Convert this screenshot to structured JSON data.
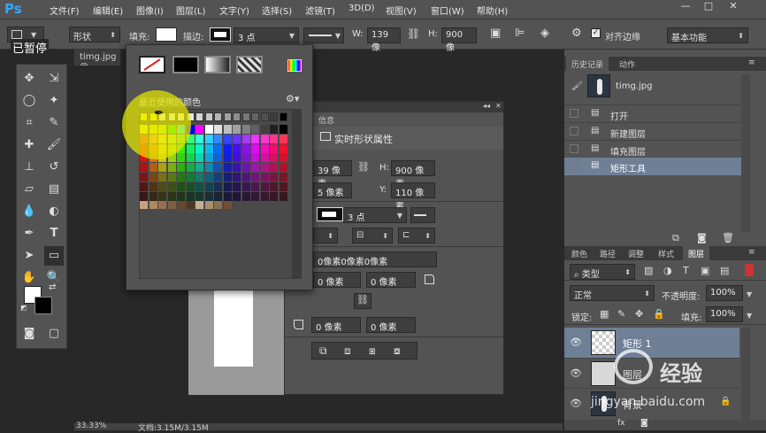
{
  "app": {
    "logo": "Ps"
  },
  "menu": {
    "items": [
      "文件(F)",
      "编辑(E)",
      "图像(I)",
      "图层(L)",
      "文字(Y)",
      "选择(S)",
      "滤镜(T)",
      "3D(D)",
      "视图(V)",
      "窗口(W)",
      "帮助(H)"
    ]
  },
  "options": {
    "shape_mode": "形状",
    "fill_label": "填充:",
    "stroke_label": "描边:",
    "stroke_width": "3 点",
    "w_label": "W:",
    "w_value": "139 像",
    "h_label": "H:",
    "h_value": "900 像",
    "align_edges_label": "对齐边缘",
    "workspace": "基本功能"
  },
  "overlay_text": "已暂停",
  "document": {
    "tab": "timg.jpg @",
    "zoom": "33.33%",
    "doc_size": "文档:3.15M/3.15M"
  },
  "swatch_panel": {
    "title": "最近使用的颜色"
  },
  "properties": {
    "tab": "信息",
    "title": "实时形状属性",
    "w_value": "39 像素",
    "h_label": "H:",
    "h_value": "900 像素",
    "x_value": "5 像素",
    "y_label": "Y:",
    "y_value": "110 像素",
    "stroke_width": "3 点",
    "corners_summary": "0像素0像素0像素",
    "corner1": "0 像素",
    "corner2": "0 像素",
    "corner3": "0 像素",
    "corner4": "0 像素"
  },
  "history": {
    "tabs": [
      "历史记录",
      "动作"
    ],
    "snapshot": "timg.jpg",
    "items": [
      "打开",
      "新建图层",
      "填充图层",
      "矩形工具"
    ]
  },
  "layers": {
    "tabs": [
      "颜色",
      "路径",
      "调整",
      "样式",
      "图层"
    ],
    "filter": "类型",
    "blend": "正常",
    "opacity_label": "不透明度:",
    "opacity": "100%",
    "lock_label": "锁定:",
    "fill_label": "填充:",
    "fill": "100%",
    "items": [
      "矩形 1",
      "图层",
      "背景"
    ]
  },
  "watermark": {
    "text1": "经验",
    "text2": "jingyan.baidu.com"
  }
}
